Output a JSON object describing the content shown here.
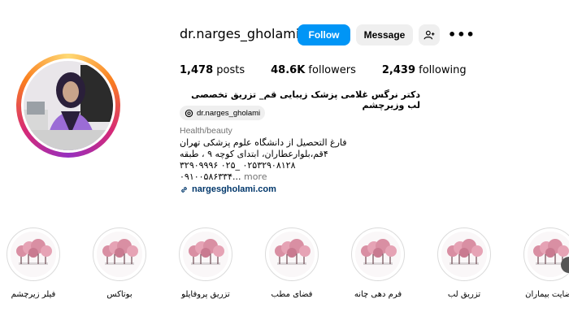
{
  "profile": {
    "username": "dr.narges_gholami",
    "follow_label": "Follow",
    "message_label": "Message",
    "more_label": "•••",
    "stats": {
      "posts_count": "1,478",
      "posts_label": "posts",
      "followers_count": "48.6K",
      "followers_label": "followers",
      "following_count": "2,439",
      "following_label": "following"
    },
    "full_name": "دکتر نرگس غلامی پزشک زیبایی قم_ تزریق تخصصی لب وزیرچشم",
    "threads_handle": "dr.narges_gholami",
    "category": "Health/beauty",
    "bio": {
      "line1": "فارغ التحصیل از دانشگاه علوم پزشکی تهران",
      "line2": "۴قم،بلوارعطاران، ابتدای کوچه ۹ ، طبقه",
      "line3": "۳۲۹۰۹۹۹۶ ۰۲۵_ ۰۲۵۳۲۹۰۸۱۲۸",
      "line4": "۰۹۱۰۰۵۸۶۳۳۴...",
      "more": " more"
    },
    "website": "nargesgholami.com"
  },
  "highlights": [
    {
      "label": "فیلر زیرچشم"
    },
    {
      "label": "بوتاکس"
    },
    {
      "label": "تزریق پروفایلو"
    },
    {
      "label": "فضای مطب"
    },
    {
      "label": "فرم دهی چانه"
    },
    {
      "label": "تزریق لب"
    },
    {
      "label": "رضایت بیماران"
    }
  ],
  "colors": {
    "follow_blue": "#0095f6",
    "link_blue": "#00376b",
    "button_gray": "#efefef"
  }
}
